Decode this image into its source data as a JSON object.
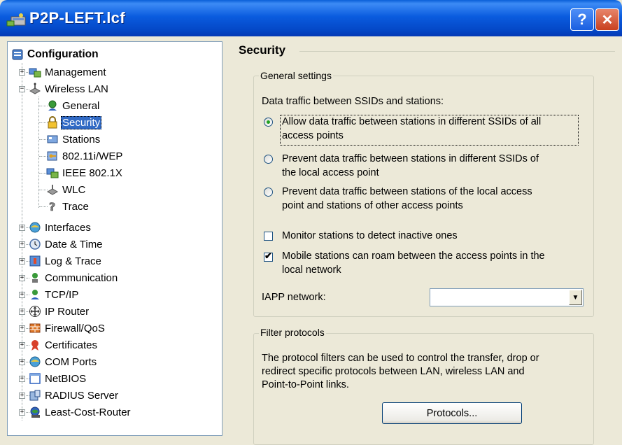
{
  "window": {
    "title": "P2P-LEFT.lcf",
    "help_icon": "question-mark",
    "close_icon": "x"
  },
  "tree": {
    "root_label": "Configuration",
    "items": [
      {
        "label": "Management",
        "icon": "management-icon"
      },
      {
        "label": "Wireless LAN",
        "icon": "wireless-lan-icon",
        "expanded": true
      },
      {
        "label": "General",
        "icon": "globe-user-icon"
      },
      {
        "label": "Security",
        "icon": "lock-icon",
        "selected": true
      },
      {
        "label": "Stations",
        "icon": "stations-icon"
      },
      {
        "label": "802.11i/WEP",
        "icon": "key-icon"
      },
      {
        "label": "IEEE 802.1X",
        "icon": "network-icon"
      },
      {
        "label": "WLC",
        "icon": "wlc-icon"
      },
      {
        "label": "Trace",
        "icon": "question-icon"
      },
      {
        "label": "Interfaces",
        "icon": "interfaces-icon"
      },
      {
        "label": "Date & Time",
        "icon": "clock-icon"
      },
      {
        "label": "Log & Trace",
        "icon": "log-icon"
      },
      {
        "label": "Communication",
        "icon": "communication-icon"
      },
      {
        "label": "TCP/IP",
        "icon": "tcpip-icon"
      },
      {
        "label": "IP Router",
        "icon": "router-icon"
      },
      {
        "label": "Firewall/QoS",
        "icon": "firewall-icon"
      },
      {
        "label": "Certificates",
        "icon": "certificate-icon"
      },
      {
        "label": "COM Ports",
        "icon": "com-ports-icon"
      },
      {
        "label": "NetBIOS",
        "icon": "netbios-icon"
      },
      {
        "label": "RADIUS Server",
        "icon": "radius-server-icon"
      },
      {
        "label": "Least-Cost-Router",
        "icon": "least-cost-router-icon"
      }
    ]
  },
  "main": {
    "section_title": "Security",
    "general": {
      "legend": "General settings",
      "traffic_label": "Data traffic between SSIDs and stations:",
      "option1_line1": "Allow data traffic between stations in different SSIDs of all",
      "option1_line2": "access points",
      "option2_line1": "Prevent data traffic between stations in different SSIDs of",
      "option2_line2": "the local access point",
      "option3_line1": "Prevent data traffic between stations of the local access",
      "option3_line2": "point and stations of other access points",
      "selected_option": 1,
      "monitor_label": "Monitor stations to detect inactive ones",
      "monitor_checked": false,
      "roam_line1": "Mobile stations can roam between the access points in the",
      "roam_line2": "local network",
      "roam_checked": true,
      "iapp_label": "IAPP network:",
      "iapp_value": ""
    },
    "filter": {
      "legend": "Filter protocols",
      "desc_line1": "The protocol filters can be used to control the transfer, drop or",
      "desc_line2": "redirect specific protocols between LAN, wireless LAN and",
      "desc_line3": "Point-to-Point links.",
      "button_label": "Protocols..."
    }
  },
  "colors": {
    "titlebar": "#0a5cdf",
    "selection": "#316ac5",
    "window_bg": "#ece9d8"
  }
}
